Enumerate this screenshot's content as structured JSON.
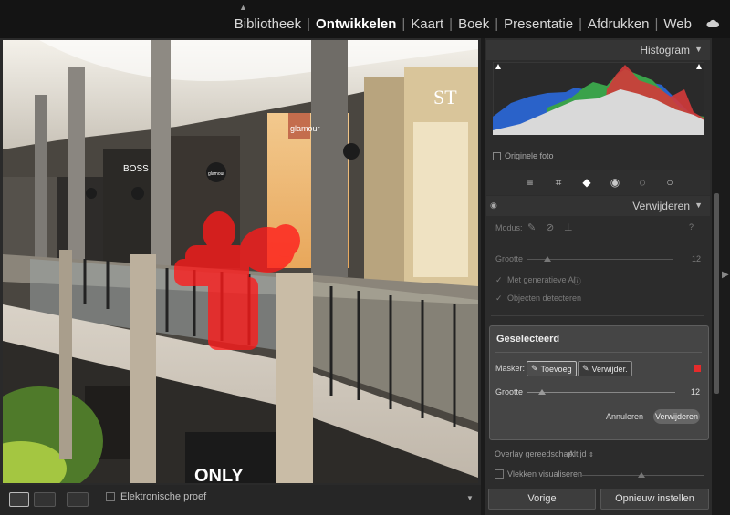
{
  "modules": [
    "Bibliotheek",
    "Ontwikkelen",
    "Kaart",
    "Boek",
    "Presentatie",
    "Afdrukken",
    "Web"
  ],
  "active_module": "Ontwikkelen",
  "icons": {
    "cloud": "cloud-icon",
    "collapse_top": "triangle-up-icon",
    "tools": [
      "sliders-icon",
      "crop-icon",
      "eraser-icon",
      "redeye-icon",
      "masking-icon",
      "presets-icon"
    ]
  },
  "histogram": {
    "title": "Histogram",
    "original_photo_label": "Originele foto"
  },
  "remove_panel": {
    "title": "Verwijderen",
    "mode_label": "Modus:",
    "size_label": "Grootte",
    "size_value": "12",
    "generative_ai_label": "Met generatieve AI",
    "detect_objects_label": "Objecten detecteren"
  },
  "selected": {
    "title": "Geselecteerd",
    "mask_label": "Masker:",
    "add_label": "Toevoeg",
    "subtract_label": "Verwijder.",
    "size_label": "Grootte",
    "size_value": "12",
    "size_fraction": 0.1,
    "cancel_label": "Annuleren",
    "remove_label": "Verwijderen",
    "mask_color": "#e52b2b"
  },
  "overlay": {
    "label": "Overlay gereedschap:",
    "value": "Altijd",
    "spots_label": "Vlekken visualiseren"
  },
  "toolbar": {
    "proof_label": "Elektronische proef"
  },
  "buttons": {
    "previous": "Vorige",
    "reset": "Opnieuw instellen"
  },
  "photo_signs": [
    "glamour",
    "BOSS",
    "ST",
    "ONLY",
    "glamour"
  ]
}
